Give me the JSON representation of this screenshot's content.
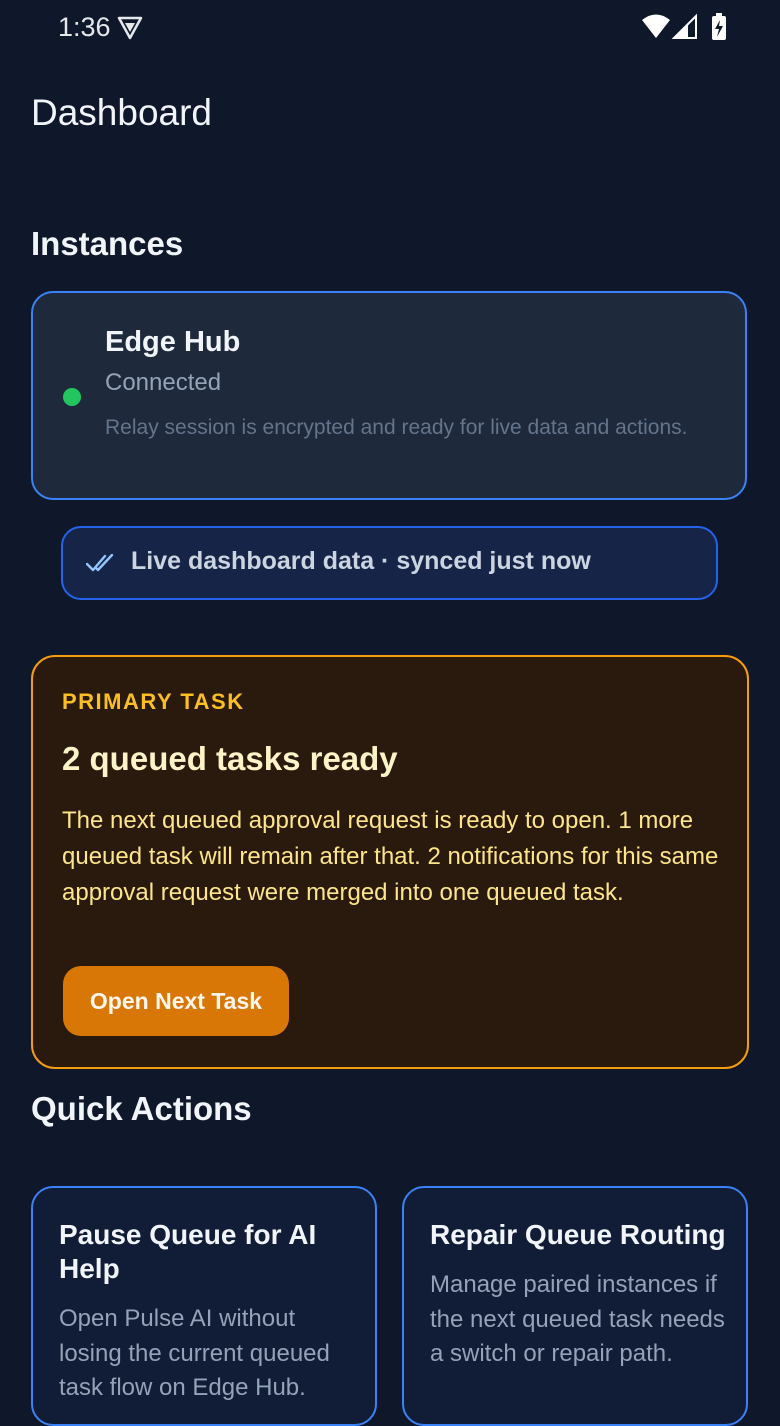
{
  "status_bar": {
    "time": "1:36"
  },
  "header": {
    "title": "Dashboard"
  },
  "instances": {
    "section_title": "Instances",
    "items": [
      {
        "name": "Edge Hub",
        "status": "Connected",
        "description": "Relay session is encrypted and ready for live data and actions.",
        "status_color": "#22c55e"
      }
    ]
  },
  "sync": {
    "label": "Live dashboard data · synced just now"
  },
  "primary_task": {
    "eyebrow": "PRIMARY TASK",
    "title": "2 queued tasks ready",
    "body": "The next queued approval request is ready to open. 1 more queued task will remain after that. 2 notifications for this same approval request were merged into one queued task.",
    "button_label": "Open Next Task"
  },
  "quick_actions": {
    "section_title": "Quick Actions",
    "items": [
      {
        "title": "Pause Queue for AI Help",
        "description": "Open Pulse AI without losing the current queued task flow on Edge Hub."
      },
      {
        "title": "Repair Queue Routing",
        "description": "Manage paired instances if the next queued task needs a switch or repair path."
      }
    ]
  },
  "colors": {
    "background": "#0f172a",
    "accent_blue": "#3b82f6",
    "accent_amber": "#f59e0b",
    "success": "#22c55e"
  }
}
